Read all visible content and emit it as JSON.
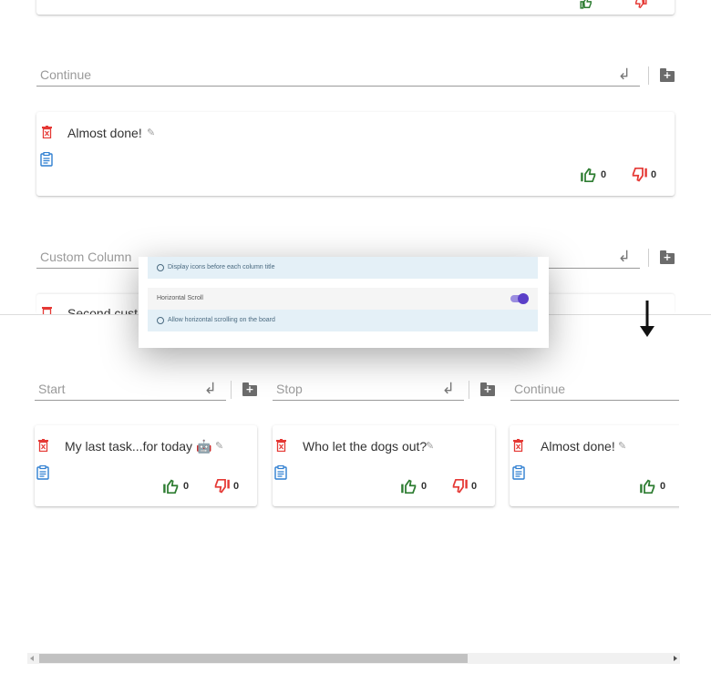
{
  "top_section": {
    "column_input": {
      "placeholder": "Continue"
    },
    "custom_column_input": {
      "placeholder": "Custom Column"
    },
    "card": {
      "title": "Almost done!",
      "likes": "0",
      "dislikes": "0"
    },
    "partial_card_title": "Second cust"
  },
  "settings_popup": {
    "display_icons_hint": "Display icons before each column title",
    "horizontal_scroll_label": "Horizontal Scroll",
    "horizontal_scroll_enabled": true,
    "horizontal_scroll_hint": "Allow horizontal scrolling on the board"
  },
  "board": {
    "columns": [
      {
        "placeholder": "Start",
        "card": {
          "title": "My last task...for today 🤖",
          "likes": "0",
          "dislikes": "0"
        }
      },
      {
        "placeholder": "Stop",
        "card": {
          "title": "Who let the dogs out?",
          "likes": "0",
          "dislikes": "0"
        }
      },
      {
        "placeholder": "Continue",
        "card": {
          "title": "Almost done!",
          "likes": "0",
          "dislikes": "0"
        }
      }
    ]
  },
  "colors": {
    "like": "#2e7d32",
    "dislike": "#e53935",
    "trash": "#e53935",
    "clipboard": "#2f7fd1",
    "toggle": "#5b3fc8",
    "info_bg": "#e4f0f7"
  },
  "icons": [
    "trash-icon",
    "clipboard-icon",
    "pencil-icon",
    "thumb-up-icon",
    "thumb-down-icon",
    "enter-icon",
    "add-folder-icon",
    "info-icon",
    "arrow-down-icon"
  ]
}
